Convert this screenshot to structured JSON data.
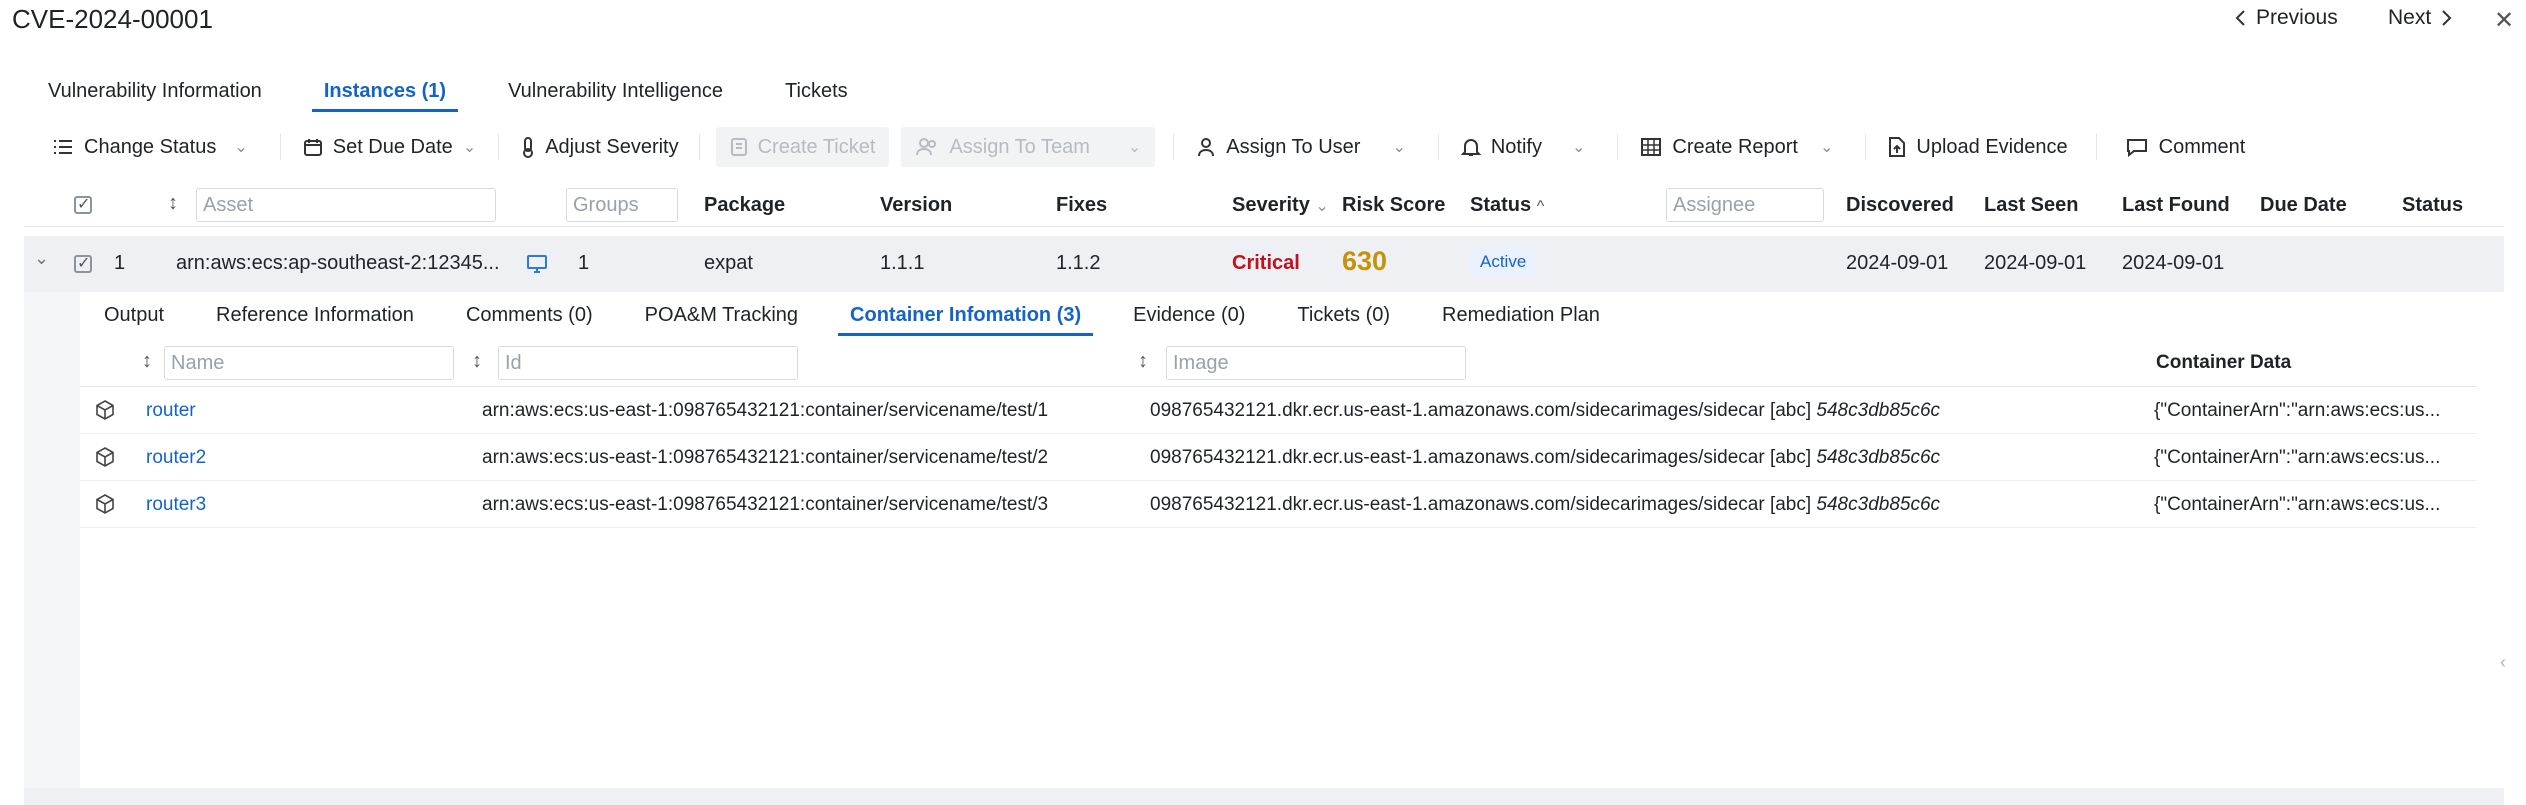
{
  "header": {
    "title": "CVE-2024-00001",
    "previous_label": "Previous",
    "next_label": "Next"
  },
  "tabs": [
    {
      "label": "Vulnerability Information"
    },
    {
      "label": "Instances (1)"
    },
    {
      "label": "Vulnerability Intelligence"
    },
    {
      "label": "Tickets"
    }
  ],
  "toolbar": {
    "change_status": "Change Status",
    "set_due_date": "Set Due Date",
    "adjust_severity": "Adjust Severity",
    "create_ticket": "Create Ticket",
    "assign_to_team": "Assign To Team",
    "assign_to_user": "Assign To User",
    "notify": "Notify",
    "create_report": "Create Report",
    "upload_evidence": "Upload Evidence",
    "comment": "Comment"
  },
  "grid": {
    "asset_placeholder": "Asset",
    "groups_placeholder": "Groups",
    "assignee_placeholder": "Assignee",
    "columns": {
      "package": "Package",
      "version": "Version",
      "fixes": "Fixes",
      "severity": "Severity",
      "risk_score": "Risk Score",
      "status": "Status",
      "discovered": "Discovered",
      "last_seen": "Last Seen",
      "last_found": "Last Found",
      "due_date": "Due Date",
      "status2": "Status"
    },
    "row": {
      "index": "1",
      "asset": "arn:aws:ecs:ap-southeast-2:12345...",
      "groups": "1",
      "package": "expat",
      "version": "1.1.1",
      "fixes": "1.1.2",
      "severity": "Critical",
      "risk_score": "630",
      "status": "Active",
      "discovered": "2024-09-01",
      "last_seen": "2024-09-01",
      "last_found": "2024-09-01",
      "due_date": ""
    }
  },
  "subtabs": [
    {
      "label": "Output"
    },
    {
      "label": "Reference Information"
    },
    {
      "label": "Comments (0)"
    },
    {
      "label": "POA&M Tracking"
    },
    {
      "label": "Container Infomation (3)"
    },
    {
      "label": "Evidence (0)"
    },
    {
      "label": "Tickets (0)"
    },
    {
      "label": "Remediation Plan"
    }
  ],
  "containers": {
    "name_placeholder": "Name",
    "id_placeholder": "Id",
    "image_placeholder": "Image",
    "data_header": "Container Data",
    "rows": [
      {
        "name": "router",
        "id": "arn:aws:ecs:us-east-1:098765432121:container/servicename/test/1",
        "image": "098765432121.dkr.ecr.us-east-1.amazonaws.com/sidecarimages/sidecar [abc]",
        "digest": "548c3db85c6c",
        "data": "{\"ContainerArn\":\"arn:aws:ecs:us..."
      },
      {
        "name": "router2",
        "id": "arn:aws:ecs:us-east-1:098765432121:container/servicename/test/2",
        "image": "098765432121.dkr.ecr.us-east-1.amazonaws.com/sidecarimages/sidecar [abc]",
        "digest": "548c3db85c6c",
        "data": "{\"ContainerArn\":\"arn:aws:ecs:us..."
      },
      {
        "name": "router3",
        "id": "arn:aws:ecs:us-east-1:098765432121:container/servicename/test/3",
        "image": "098765432121.dkr.ecr.us-east-1.amazonaws.com/sidecarimages/sidecar [abc]",
        "digest": "548c3db85c6c",
        "data": "{\"ContainerArn\":\"arn:aws:ecs:us..."
      }
    ]
  },
  "icons": {
    "previous": "chevron-left-icon",
    "next": "chevron-right-icon",
    "close": "close-icon",
    "cube": "cube-icon",
    "monitor": "monitor-icon"
  },
  "colors": {
    "accent": "#1464c8",
    "critical": "#c0121e",
    "score": "#c4930a"
  }
}
